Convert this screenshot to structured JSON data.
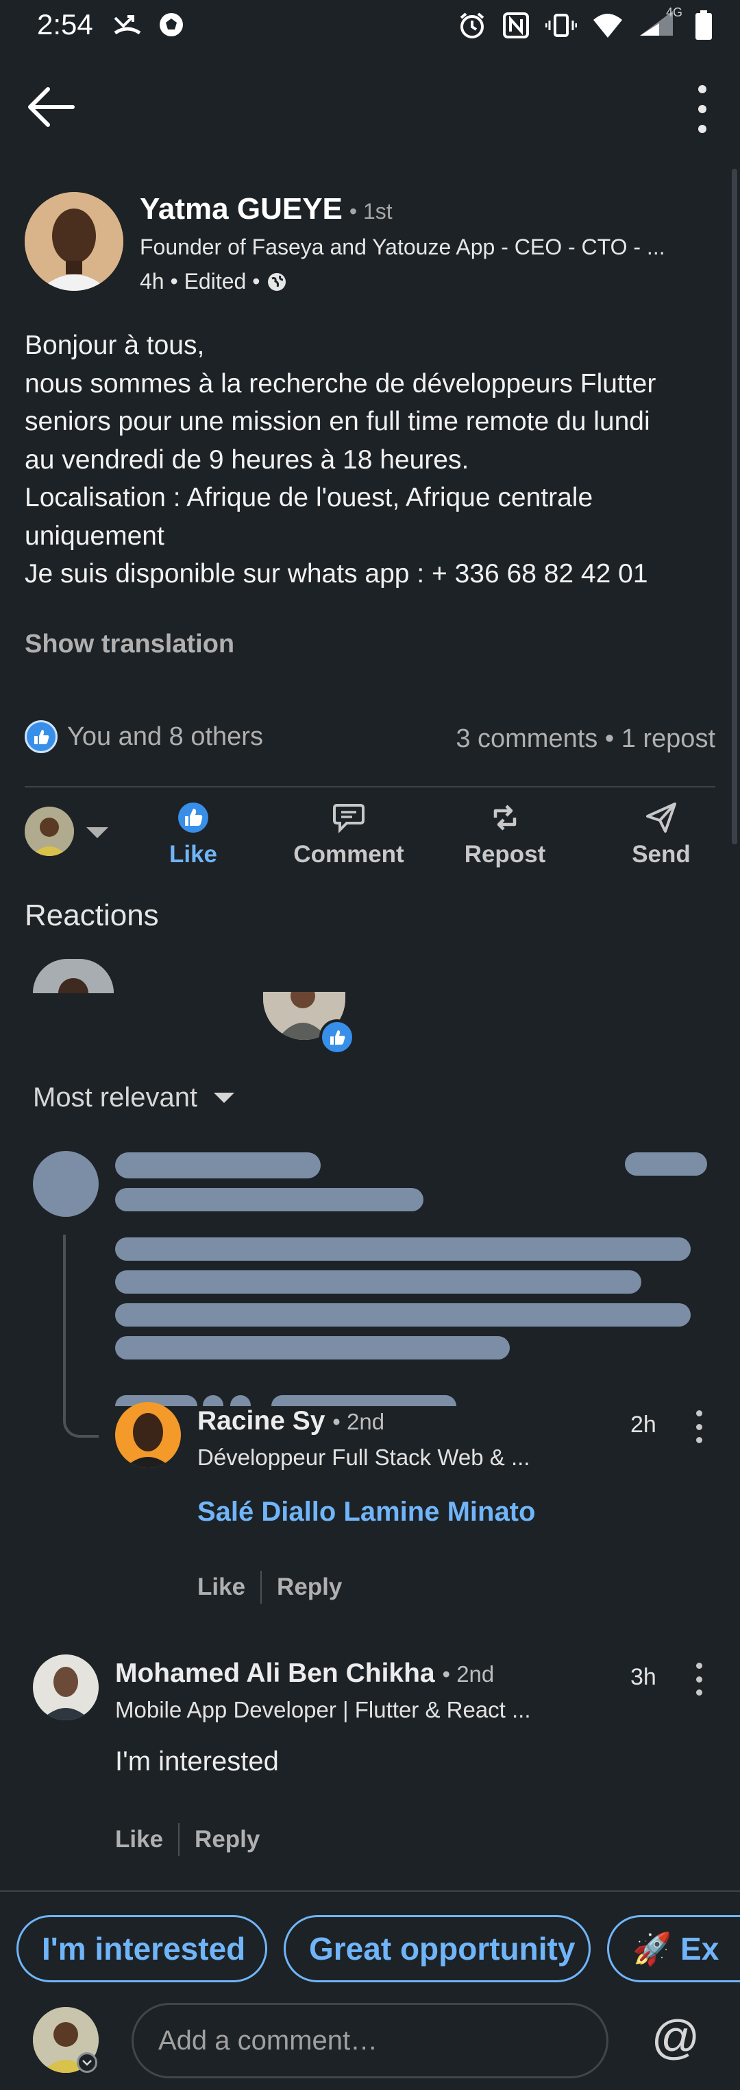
{
  "status_bar": {
    "time": "2:54",
    "icons": [
      "missed-call-icon",
      "soccer-ball-icon",
      "alarm-icon",
      "nfc-icon",
      "vibrate-icon",
      "wifi-icon",
      "signal-icon",
      "battery-icon"
    ],
    "network": "4G"
  },
  "post": {
    "author": {
      "name": "Yatma GUEYE",
      "degree": "• 1st",
      "headline": "Founder of Faseya and Yatouze App - CEO - CTO - ...",
      "meta": "4h • Edited •"
    },
    "body_lines": [
      "Bonjour à tous,",
      "nous sommes à la recherche de développeurs Flutter",
      "seniors pour une mission en full time remote du lundi",
      "au vendredi de 9 heures à 18 heures.",
      "Localisation : Afrique de l'ouest, Afrique centrale",
      "uniquement",
      "Je suis disponible sur whats app : + 336 68 82 42 01"
    ],
    "show_translation": "Show translation",
    "reactions_summary": "You and 8 others",
    "comments_summary": "3 comments • 1 repost"
  },
  "actions": {
    "like": "Like",
    "comment": "Comment",
    "repost": "Repost",
    "send": "Send"
  },
  "reactions": {
    "heading": "Reactions"
  },
  "sort": {
    "label": "Most relevant"
  },
  "comments": [
    {
      "name": "Racine Sy",
      "degree": "• 2nd",
      "headline": "Développeur Full Stack Web & ...",
      "time": "2h",
      "mention": "Salé Diallo Lamine Minato",
      "like": "Like",
      "reply": "Reply"
    },
    {
      "name": "Mohamed Ali Ben Chikha",
      "degree": "• 2nd",
      "headline": "Mobile App Developer | Flutter & React ...",
      "time": "3h",
      "text": "I'm interested",
      "like": "Like",
      "reply": "Reply"
    }
  ],
  "quick_replies": [
    "I'm interested",
    "Great opportunity",
    "🚀 Ex"
  ],
  "composer": {
    "placeholder": "Add a comment…",
    "mention_symbol": "@"
  },
  "colors": {
    "background": "#1d2226",
    "accent": "#70b5f9",
    "like_blue": "#378fe9",
    "skeleton": "#7b8ea6"
  }
}
